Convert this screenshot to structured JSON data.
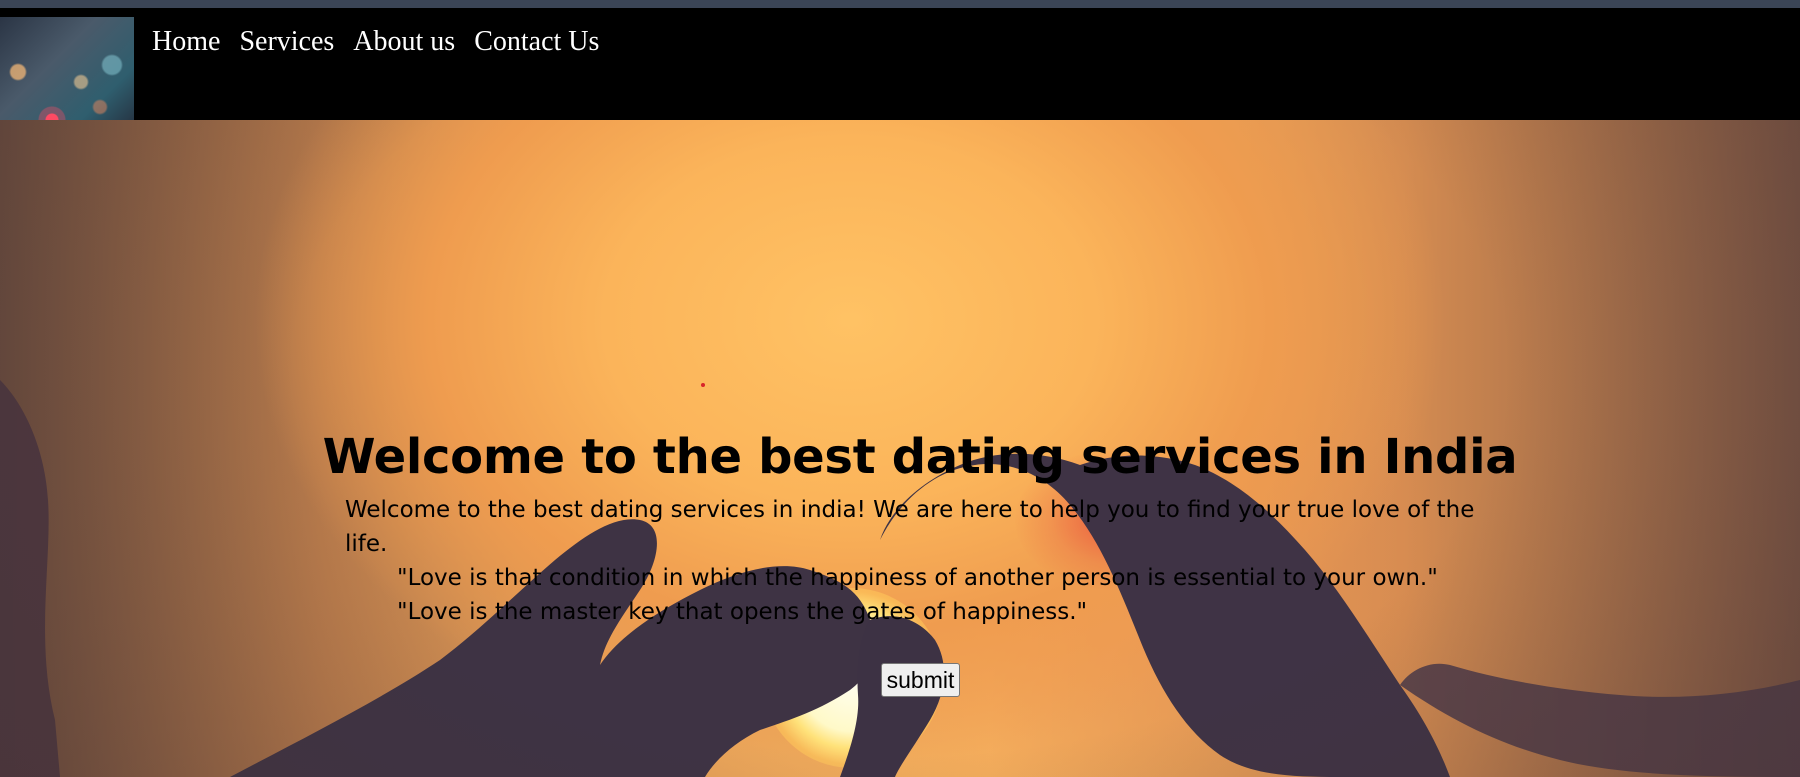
{
  "nav": {
    "links": [
      {
        "label": "Home"
      },
      {
        "label": "Services"
      },
      {
        "label": "About us"
      },
      {
        "label": "Contact Us"
      }
    ]
  },
  "hero": {
    "title": "Welcome to the best dating services in India",
    "intro": "Welcome to the best dating services in india! We are here to help you to find your true love of the life.",
    "quotes": [
      "\"Love is that condition in which the happiness of another person is essential to your own.\"",
      "\"Love is the master key that opens the gates of happiness.\""
    ],
    "submit_label": "submit"
  },
  "colors": {
    "navbar": "#000000",
    "nav_text": "#ffffff",
    "hero_accent": "#fbb45a"
  }
}
